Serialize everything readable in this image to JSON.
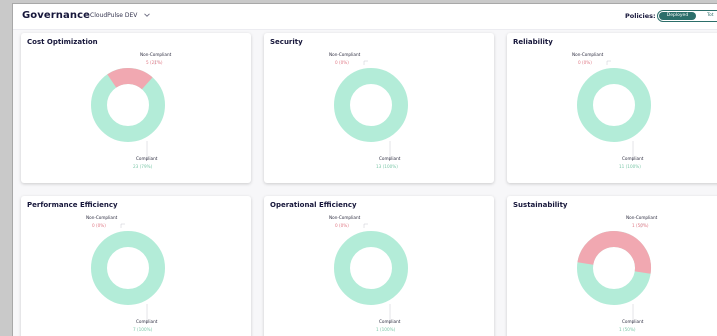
{
  "header": {
    "title": "Governance",
    "environment": "CloudPulse DEV",
    "policies_label": "Policies:",
    "toggle": {
      "active": "Deployed",
      "inactive": "Tot"
    }
  },
  "colors": {
    "compliant": "#b3ecd8",
    "non_compliant": "#f1a8b1"
  },
  "cards": [
    {
      "title": "Cost Optimization",
      "non_label": "Non-Compliant",
      "non_value": "5 (21%)",
      "comp_label": "Compliant",
      "comp_value": "23 (79%)",
      "non_compliant_fraction": 0.21
    },
    {
      "title": "Security",
      "non_label": "Non-Compliant",
      "non_value": "0 (0%)",
      "comp_label": "Compliant",
      "comp_value": "13 (100%)",
      "non_compliant_fraction": 0
    },
    {
      "title": "Reliability",
      "non_label": "Non-Compliant",
      "non_value": "0 (0%)",
      "comp_label": "Compliant",
      "comp_value": "11 (100%)",
      "non_compliant_fraction": 0
    },
    {
      "title": "Performance Efficiency",
      "non_label": "Non-Compliant",
      "non_value": "0 (0%)",
      "comp_label": "Compliant",
      "comp_value": "7 (100%)",
      "non_compliant_fraction": 0
    },
    {
      "title": "Operational Efficiency",
      "non_label": "Non-Compliant",
      "non_value": "0 (0%)",
      "comp_label": "Compliant",
      "comp_value": "1 (100%)",
      "non_compliant_fraction": 0
    },
    {
      "title": "Sustainability",
      "non_label": "Non-Compliant",
      "non_value": "1 (50%)",
      "comp_label": "Compliant",
      "comp_value": "1 (50%)",
      "non_compliant_fraction": 0.5
    }
  ]
}
